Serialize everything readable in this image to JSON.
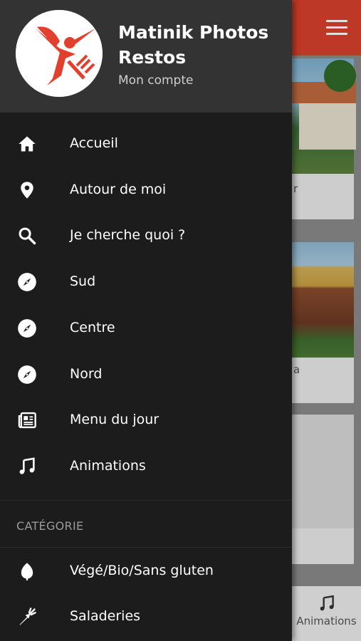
{
  "drawer": {
    "title": "Matinik Photos Restos",
    "account_link": "Mon compte",
    "menu": [
      {
        "label": "Accueil",
        "icon": "home-icon"
      },
      {
        "label": "Autour de moi",
        "icon": "location-pin-icon"
      },
      {
        "label": "Je cherche quoi ?",
        "icon": "search-icon"
      },
      {
        "label": "Sud",
        "icon": "compass-icon"
      },
      {
        "label": "Centre",
        "icon": "compass-icon"
      },
      {
        "label": "Nord",
        "icon": "compass-icon"
      },
      {
        "label": "Menu du jour",
        "icon": "newspaper-icon"
      },
      {
        "label": "Animations",
        "icon": "music-note-icon"
      }
    ],
    "section_header": "CATÉGORIE",
    "categories": [
      {
        "label": "Végé/Bio/Sans gluten",
        "icon": "leaf-icon"
      },
      {
        "label": "Saladeries",
        "icon": "carrot-icon"
      }
    ]
  },
  "background": {
    "card_fragments": [
      "r",
      "a"
    ],
    "bottom_tab_label": "Animations"
  },
  "colors": {
    "topbar": "#d8402d",
    "drawer_bg": "#1c1c1c",
    "header_bg": "#333333",
    "logo_red": "#e2402f"
  }
}
